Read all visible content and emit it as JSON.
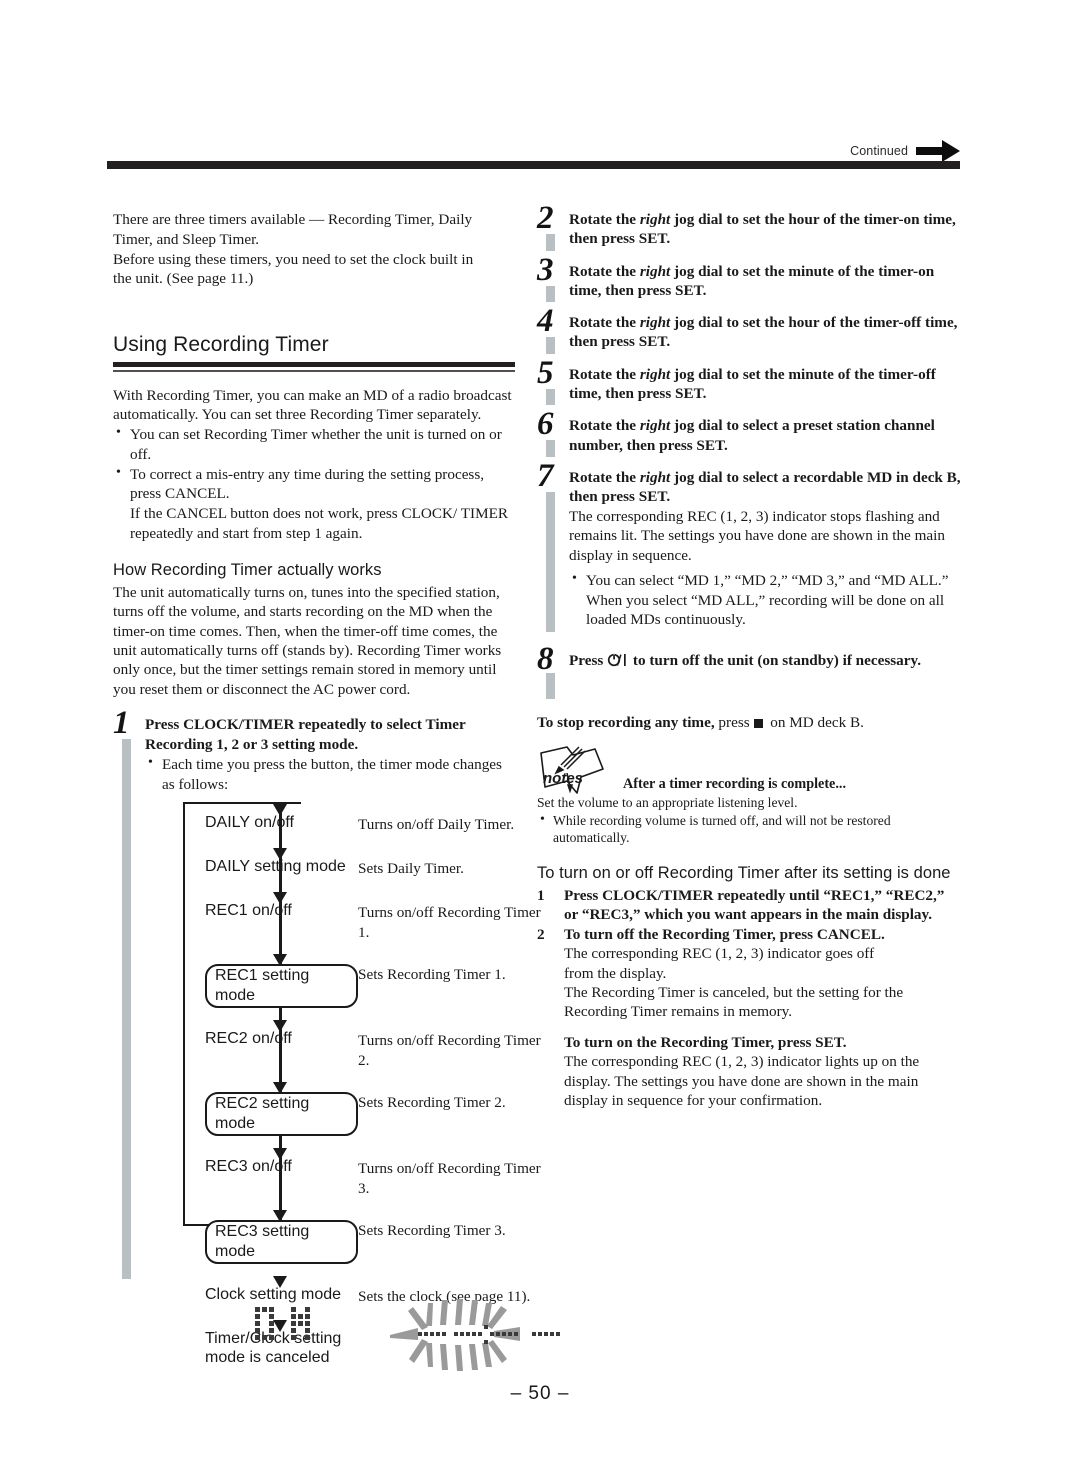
{
  "page": {
    "number_label": "– 50 –",
    "continued_label": "Continued"
  },
  "left_column": {
    "intro": "There are three timers available — Recording Timer, Daily Timer, and Sleep Timer.\nBefore using these timers, you need to set the clock built in the unit. (See page 11.)",
    "intro_line1": "There are three timers available — Recording Timer, Daily",
    "intro_line2": "Timer, and Sleep Timer.",
    "intro_line3": "Before using these timers, you need to set the clock built in",
    "intro_line4": "the unit. (See page 11.)",
    "section_title": "Using Recording Timer",
    "section_intro": "With Recording Timer, you can make an MD of a radio broadcast automatically. You can set three Recording Timer separately.",
    "bullets": [
      "You can set Recording Timer whether the unit is turned on or off.",
      "To correct a mis-entry any time during the setting process, press CANCEL."
    ],
    "bullet2_extra": "If the CANCEL button does not work, press CLOCK/ TIMER repeatedly and start from step 1 again.",
    "how_heading": "How Recording Timer actually works",
    "how_body": "The unit automatically turns on, tunes into the specified station, turns off the volume, and starts recording on the MD when the timer-on time comes. Then, when the timer-off time comes, the unit automatically turns off (stands by). Recording Timer works only once, but the timer settings remain stored in memory until you reset them or disconnect the AC power cord.",
    "step1": {
      "number": "1",
      "head": "Press CLOCK/TIMER repeatedly to select Timer Recording 1, 2 or 3 setting mode.",
      "bullet": "Each time you press the button, the timer mode changes as follows:"
    },
    "flowchart": {
      "rows": [
        {
          "label": "DAILY on/off",
          "boxed": false,
          "desc": "Turns on/off Daily Timer."
        },
        {
          "label": "DAILY setting mode",
          "boxed": false,
          "desc": "Sets Daily Timer."
        },
        {
          "label": "REC1 on/off",
          "boxed": false,
          "desc": "Turns on/off Recording Timer 1."
        },
        {
          "label": "REC1 setting mode",
          "boxed": true,
          "desc": "Sets Recording Timer 1."
        },
        {
          "label": "REC2 on/off",
          "boxed": false,
          "desc": "Turns on/off Recording Timer 2."
        },
        {
          "label": "REC2 setting mode",
          "boxed": true,
          "desc": "Sets Recording Timer 2."
        },
        {
          "label": "REC3 on/off",
          "boxed": false,
          "desc": "Turns on/off Recording Timer 3."
        },
        {
          "label": "REC3 setting mode",
          "boxed": true,
          "desc": "Sets Recording Timer 3."
        },
        {
          "label": "Clock setting mode",
          "boxed": false,
          "desc": "Sets the clock (see page 11)."
        },
        {
          "label": "Timer/Clock setting mode is canceled",
          "boxed": false,
          "desc": ""
        }
      ]
    },
    "lcd": {
      "on_text": "ON",
      "flashing_time": "flashing-time-display"
    }
  },
  "right_column": {
    "steps": [
      {
        "number": "2",
        "head_pre": "Rotate the ",
        "head_em": "right",
        "head_post": " jog dial to set the hour of the timer-on time, then press SET."
      },
      {
        "number": "3",
        "head_pre": "Rotate the ",
        "head_em": "right",
        "head_post": " jog dial to set the minute of the timer-on time, then press SET."
      },
      {
        "number": "4",
        "head_pre": "Rotate the ",
        "head_em": "right",
        "head_post": " jog dial to set the hour of the timer-off time, then press SET."
      },
      {
        "number": "5",
        "head_pre": "Rotate the ",
        "head_em": "right",
        "head_post": " jog dial to set the minute of the timer-off time, then press SET."
      },
      {
        "number": "6",
        "head_pre": "Rotate the ",
        "head_em": "right",
        "head_post": " jog dial to select a preset station channel number, then press SET."
      }
    ],
    "step7": {
      "number": "7",
      "head_pre": "Rotate the ",
      "head_em": "right",
      "head_post": " jog dial to select a recordable MD in deck B, then press SET.",
      "body": "The corresponding REC (1, 2, 3) indicator stops flashing and remains lit. The settings you have done are shown in the main display in sequence.",
      "bullet": "You can select “MD 1,” “MD 2,” “MD 3,” and “MD ALL.” When you select “MD ALL,” recording will be done on all loaded MDs continuously."
    },
    "step8": {
      "number": "8",
      "head_pre": "Press ",
      "head_icon": "power-standby-icon",
      "head_post": " to turn off the unit (on standby) if necessary."
    },
    "stop_note_bold": "To stop recording any time,",
    "stop_note_rest_pre": " press ",
    "stop_note_icon": "stop-square-icon",
    "stop_note_rest_post": " on MD deck B.",
    "notes": {
      "icon_label": "notes",
      "title": "After a timer recording is complete...",
      "body": "Set the volume to an appropriate listening level.",
      "bullets": [
        "While recording volume is turned off, and will not be restored automatically."
      ]
    },
    "turn_on_off": {
      "heading": "To turn on or off Recording Timer after its setting is done",
      "items": [
        {
          "n": "1",
          "bold": "Press CLOCK/TIMER repeatedly until “REC1,” “REC2,” or “REC3,” which you want appears in the main display.",
          "body": ""
        },
        {
          "n": "2",
          "bold": "To turn off the Recording Timer, press CANCEL.",
          "body": "The corresponding REC (1, 2, 3) indicator goes off from the display.\nThe Recording Timer is canceled, but the setting for the Recording Timer remains in memory."
        }
      ],
      "item2_body_line1": "The corresponding REC (1, 2, 3) indicator goes off",
      "item2_body_line2": "from the display.",
      "item2_body_line3": "The Recording Timer is canceled, but the setting for the",
      "item2_body_line4": "Recording Timer remains in memory.",
      "turn_on_bold": "To turn on the Recording Timer, press SET.",
      "turn_on_body": "The corresponding REC (1, 2, 3) indicator lights up on the display. The settings you have done are shown in the main display in sequence for your confirmation."
    }
  },
  "colors": {
    "ink": "#1a1a1a",
    "rule": "#231f20",
    "spine_gray": "#b8c0c4",
    "lcd_gray": "#8a8a8a"
  }
}
